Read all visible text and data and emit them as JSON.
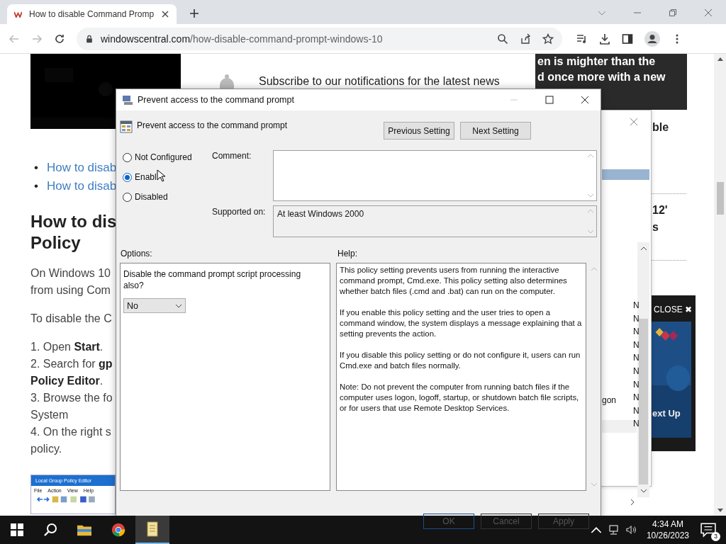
{
  "browser": {
    "tab_title": "How to disable Command Promp",
    "url_host": "windowscentral.com",
    "url_path": "/how-disable-command-prompt-windows-10"
  },
  "page": {
    "banner_lines": [
      "en is mighter than the",
      "d once more with a new"
    ],
    "subscribe": "Subscribe to our notifications for the latest news",
    "links": [
      {
        "bullet": "•",
        "text": "How to disab"
      },
      {
        "bullet": "•",
        "text": "How to disab"
      }
    ],
    "heading_lines": [
      "How to dis",
      "Policy"
    ],
    "paragraphs": [
      [
        "On Windows 10",
        "from using Com"
      ],
      [
        "To disable the C"
      ],
      [
        "1. Open **Start**.",
        "2. Search for **gp**",
        "**Policy Editor**.",
        "3. Browse the fo",
        "System",
        "4. On the right s",
        "policy."
      ]
    ],
    "thumbnail": {
      "title": "Local Group Policy Editor",
      "menu": [
        "File",
        "Action",
        "View",
        "Help"
      ]
    },
    "side_texts": [
      "ble",
      "12'",
      "s"
    ],
    "ad": {
      "close": "CLOSE ✖",
      "next": "ext Up"
    }
  },
  "background_window": {
    "list_texts": [
      "gon"
    ],
    "column_letters": [
      "N",
      "N",
      "N",
      "N",
      "N",
      "N",
      "N",
      "N",
      "N",
      "N"
    ]
  },
  "dialog": {
    "title": "Prevent access to the command prompt",
    "setting_name": "Prevent access to the command prompt",
    "nav_buttons": [
      "Previous Setting",
      "Next Setting"
    ],
    "states": [
      {
        "label": "Not Configured",
        "selected": false
      },
      {
        "label": "Enabl",
        "selected": true
      },
      {
        "label": "Disabled",
        "selected": false
      }
    ],
    "comment_label": "Comment:",
    "supported_label": "Supported on:",
    "supported_value": "At least Windows 2000",
    "options_label": "Options:",
    "help_label": "Help:",
    "option_prompt": "Disable the command prompt script processing also?",
    "option_value": "No",
    "help_paragraphs": [
      "This policy setting prevents users from running the interactive command prompt, Cmd.exe.  This policy setting also determines whether batch files (.cmd and .bat) can run on the computer.",
      "If you enable this policy setting and the user tries to open a command window, the system displays a message explaining that a setting prevents the action.",
      "If you disable this policy setting or do not configure it, users can run Cmd.exe and batch files normally.",
      "Note: Do not prevent the computer from running batch files if the computer uses logon, logoff, startup, or shutdown batch file scripts, or for users that use Remote Desktop Services."
    ],
    "buttons": [
      "OK",
      "Cancel",
      "Apply"
    ]
  },
  "taskbar": {
    "time": "4:34 AM",
    "date": "10/26/2023",
    "notifications": "3"
  }
}
